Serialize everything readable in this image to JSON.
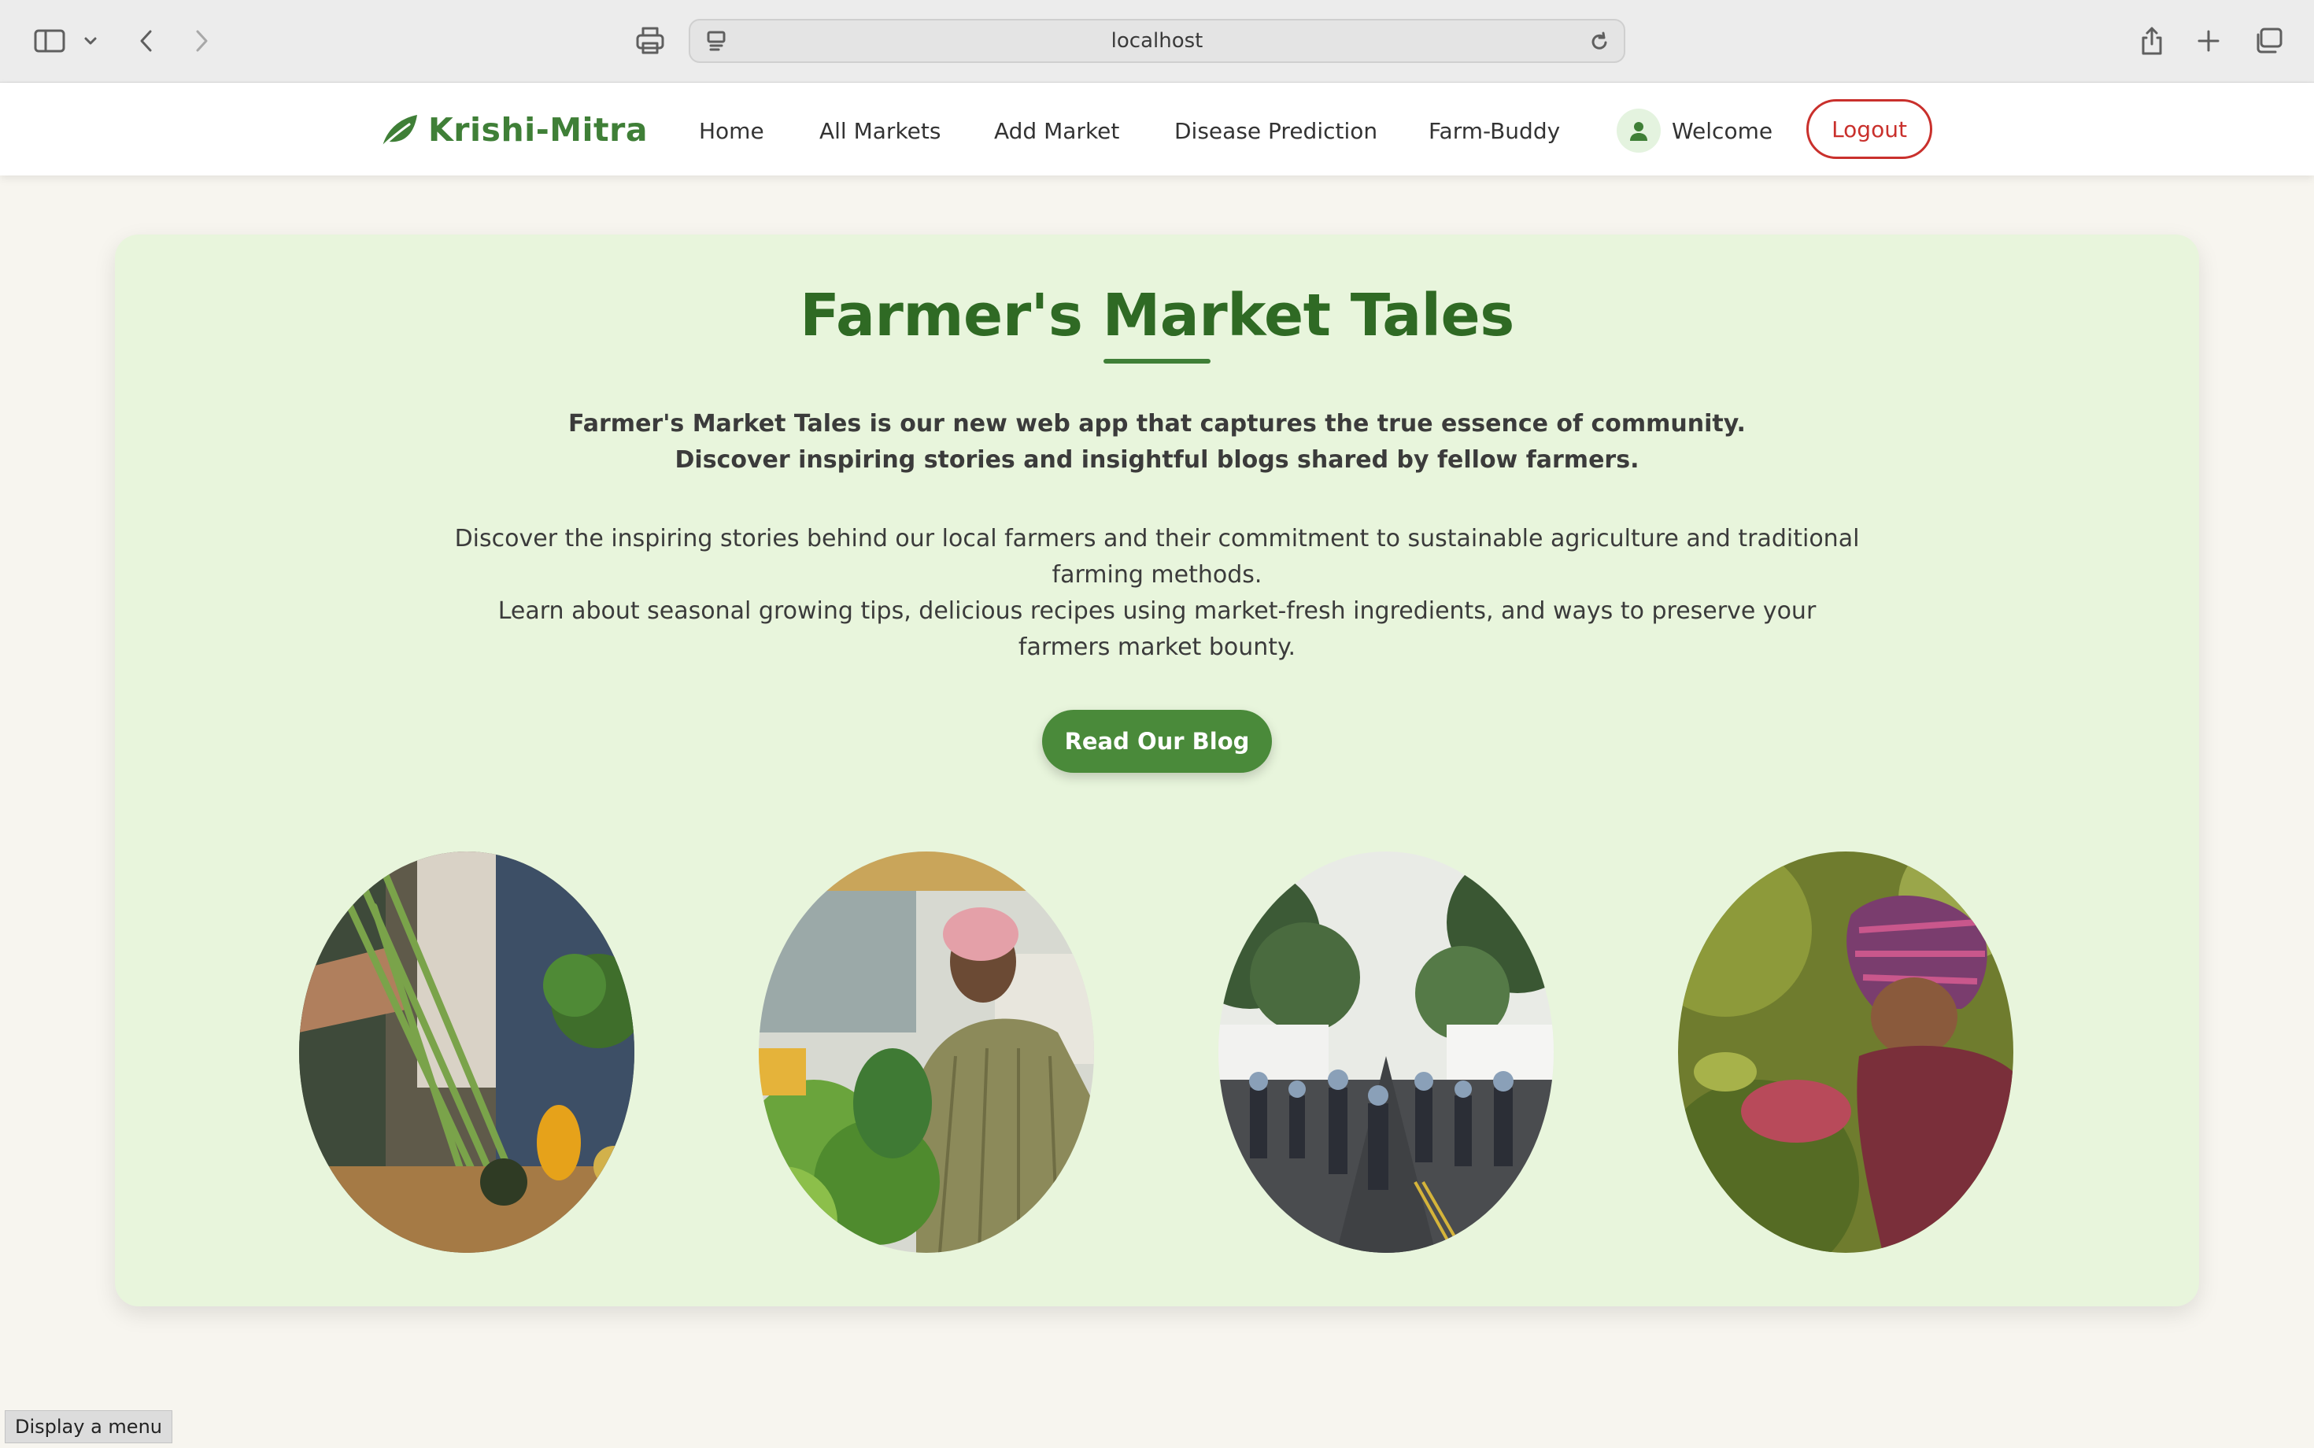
{
  "browser": {
    "url": "localhost",
    "icons": [
      "sidebar-icon",
      "chevron-down-icon",
      "back-icon",
      "forward-icon",
      "print-icon",
      "site-icon",
      "reload-icon",
      "share-icon",
      "plus-icon",
      "tabs-icon"
    ]
  },
  "nav": {
    "brand": "Krishi-Mitra",
    "links": [
      "Home",
      "All Markets",
      "Add Market",
      "Disease Prediction",
      "Farm-Buddy"
    ],
    "welcome": "Welcome",
    "logout": "Logout"
  },
  "hero": {
    "title": "Farmer's Market Tales",
    "lead_1": "Farmer's Market Tales is our new web app that captures the true essence of community.",
    "lead_2": "Discover inspiring stories and insightful blogs shared by fellow farmers.",
    "body_1": "Discover the inspiring stories behind our local farmers and their commitment to sustainable agriculture and traditional farming methods.",
    "body_2": "Learn about seasonal growing tips, delicious recipes using market-fresh ingredients, and ways to preserve your farmers market bounty.",
    "cta": "Read Our Blog"
  },
  "tooltip": "Display a menu",
  "colors": {
    "brand_green": "#3f7f37",
    "title_green": "#2f6a24",
    "button_green": "#4a8a3a",
    "card_bg": "#e8f5dc",
    "page_bg": "#f7f5ef",
    "logout_red": "#c9302c"
  }
}
